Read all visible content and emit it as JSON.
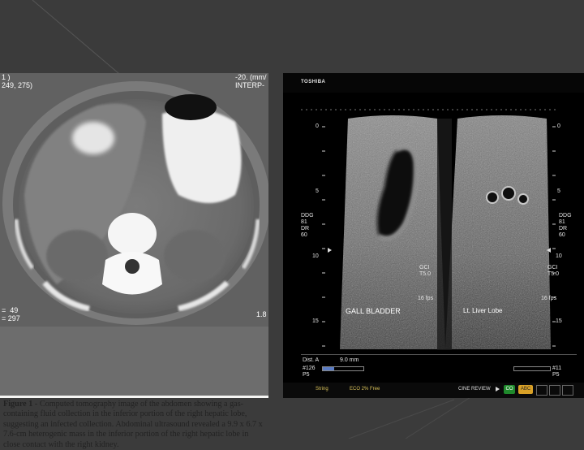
{
  "slide": {
    "background": "#3b3b3b"
  },
  "ct_figure": {
    "overlay_top_left": "1 )\n249, 275)",
    "overlay_top_right": "-20. (mm/\nINTERP-",
    "overlay_bottom_left": "=  49\n= 297",
    "overlay_bottom_right": "1.8",
    "caption_label": "Figure 1 -",
    "caption_text": " Computed tomography image of the abdomen showing a gas-containing fluid collection in the inferior portion of the right hepatic lobe, suggesting an infected collection. Abdominal ultrasound revealed a 9.9 x 6.7 x 7.6-cm heterogenic mass in the inferior portion of the right hepatic lobe in close contact with the right kidney."
  },
  "ultrasound": {
    "brand": "TOSHIBA",
    "depth_top": "0",
    "depth_5": "5",
    "depth_10": "10",
    "depth_15": "15",
    "right_top": "0",
    "right_5": "5",
    "right_10": "10",
    "right_15": "15",
    "left_params": "DDG\n81\nDR\n60",
    "left_params_low": "GCI\nT5.0",
    "left_fps": "16 fps",
    "right_params": "DDG\n81\nDR\n60",
    "right_params_low": "GCI\nT5.0",
    "right_fps": "16 fps",
    "label_left": "GALL BLADDER",
    "label_right": "Lt. Liver Lobe",
    "measure_label": "Dist. A",
    "measure_value": "9.0 mm",
    "frame_left": "#126",
    "frame_left_sub": "P5",
    "frame_right": "#11",
    "frame_right_sub": "P5",
    "footer_string": "String",
    "footer_mode": "ECO 2% Free",
    "footer_cine": "CINE REVIEW",
    "footer_btn_a": "CO",
    "footer_btn_b": "ABC"
  }
}
